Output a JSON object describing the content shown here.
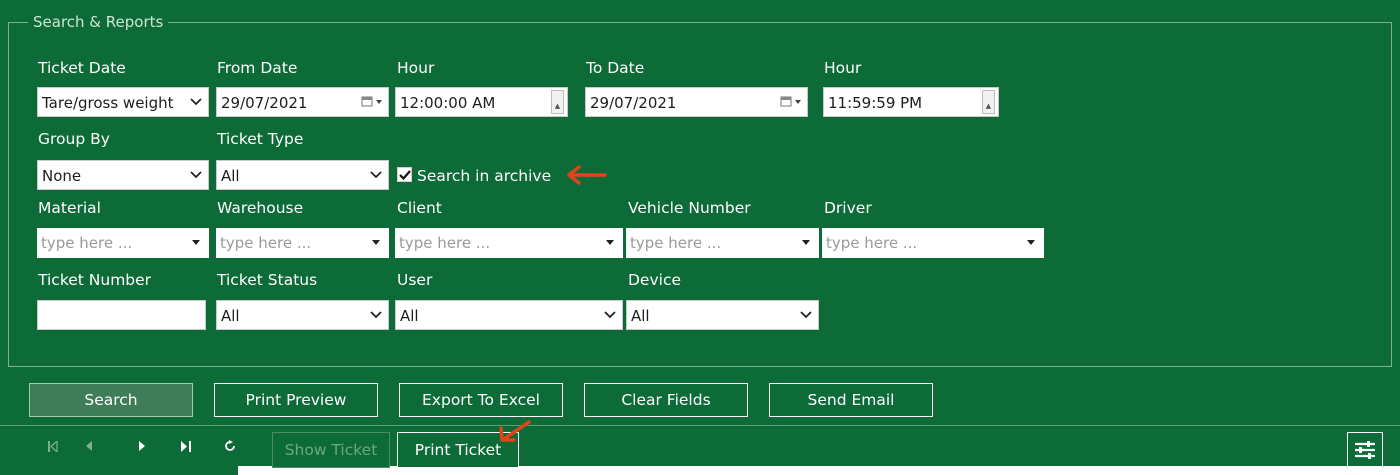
{
  "group": {
    "title": "Search & Reports"
  },
  "labels": {
    "ticket_date": "Ticket Date",
    "from_date": "From Date",
    "hour_from": "Hour",
    "to_date": "To Date",
    "hour_to": "Hour",
    "group_by": "Group By",
    "ticket_type": "Ticket Type",
    "material": "Material",
    "warehouse": "Warehouse",
    "client": "Client",
    "vehicle_number": "Vehicle Number",
    "driver": "Driver",
    "ticket_number": "Ticket Number",
    "ticket_status": "Ticket Status",
    "user": "User",
    "device": "Device"
  },
  "fields": {
    "ticket_date": "Tare/gross weight",
    "from_date": "29/07/2021",
    "hour_from": "12:00:00 AM",
    "to_date": "29/07/2021",
    "hour_to": "11:59:59 PM",
    "group_by": "None",
    "ticket_type": "All",
    "search_archive": "Search in archive",
    "material_placeholder": "type here ...",
    "warehouse_placeholder": "type here ...",
    "client_placeholder": "type here ...",
    "vehicle_placeholder": "type here ...",
    "driver_placeholder": "type here ...",
    "ticket_number": "",
    "ticket_status": "All",
    "user": "All",
    "device": "All"
  },
  "buttons": {
    "search": "Search",
    "print_preview": "Print Preview",
    "export_excel": "Export To Excel",
    "clear_fields": "Clear Fields",
    "send_email": "Send Email",
    "show_ticket": "Show Ticket",
    "print_ticket": "Print Ticket"
  },
  "colors": {
    "background": "#0d6b37",
    "annotation_arrow": "#e0441c"
  }
}
